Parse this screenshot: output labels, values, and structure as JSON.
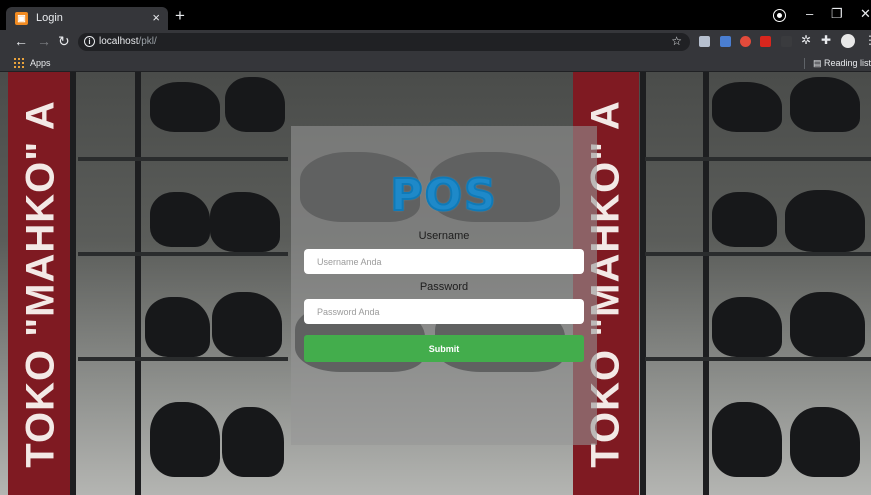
{
  "browser": {
    "tab": {
      "title": "Login",
      "favicon": "pos-favicon",
      "close_icon": "×"
    },
    "new_tab_icon": "+",
    "window_controls": [
      "profile-icon",
      "minimize-icon",
      "restore-icon",
      "close-icon"
    ],
    "address_bar": {
      "host": "localhost",
      "path": "/pkl/",
      "info_icon": "i"
    },
    "extensions": [
      "shield-extension-icon",
      "translate-extension-icon",
      "record-extension-icon",
      "mail-extension-icon",
      "camera-extension-icon",
      "gear-extension-icon",
      "puzzle-extension-icon",
      "avatar-icon",
      "menu-icon"
    ],
    "bookmarks": {
      "apps_label": "Apps",
      "reading_list_label": "Reading list"
    }
  },
  "page": {
    "background_banner_text": "TOKO \"MAHKO\" A",
    "login": {
      "logo_text": "POS",
      "username_label": "Username",
      "username_placeholder": "Username Anda",
      "password_label": "Password",
      "password_placeholder": "Password Anda",
      "submit_label": "Submit"
    }
  },
  "colors": {
    "submit": "#43ad4c",
    "logo": "#1e89c9",
    "banner": "#7f1a22"
  }
}
